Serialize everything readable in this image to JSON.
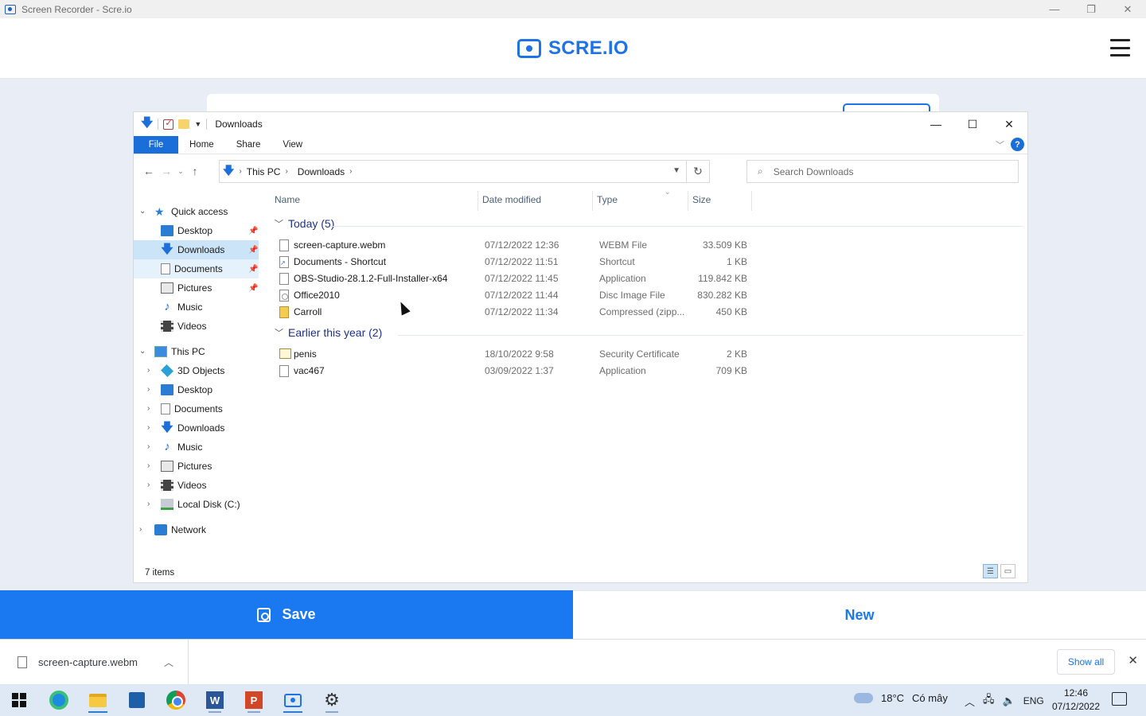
{
  "app_window": {
    "title": "Screen Recorder - Scre.io",
    "controls": [
      "—",
      "❐",
      "✕"
    ]
  },
  "site": {
    "logo_text": "SCRE.IO"
  },
  "explorer": {
    "title": "Downloads",
    "ribbon_tabs": [
      "File",
      "Home",
      "Share",
      "View"
    ],
    "breadcrumb": [
      "This PC",
      "Downloads"
    ],
    "search_placeholder": "Search Downloads",
    "nav": {
      "quick_access": "Quick access",
      "quick_items": [
        "Desktop",
        "Downloads",
        "Documents",
        "Pictures",
        "Music",
        "Videos"
      ],
      "this_pc": "This PC",
      "pc_items": [
        "3D Objects",
        "Desktop",
        "Documents",
        "Downloads",
        "Music",
        "Pictures",
        "Videos",
        "Local Disk (C:)"
      ],
      "network": "Network"
    },
    "columns": {
      "name": "Name",
      "date": "Date modified",
      "type": "Type",
      "size": "Size"
    },
    "groups": [
      {
        "label": "Today (5)",
        "files": [
          {
            "name": "screen-capture.webm",
            "date": "07/12/2022 12:36",
            "type": "WEBM File",
            "size": "33.509 KB",
            "icon": "file-icon"
          },
          {
            "name": "Documents - Shortcut",
            "date": "07/12/2022 11:51",
            "type": "Shortcut",
            "size": "1 KB",
            "icon": "shortcut-icon"
          },
          {
            "name": "OBS-Studio-28.1.2-Full-Installer-x64",
            "date": "07/12/2022 11:45",
            "type": "Application",
            "size": "119.842 KB",
            "icon": "file-icon"
          },
          {
            "name": "Office2010",
            "date": "07/12/2022 11:44",
            "type": "Disc Image File",
            "size": "830.282 KB",
            "icon": "disc-image-icon"
          },
          {
            "name": "Carroll",
            "date": "07/12/2022 11:34",
            "type": "Compressed (zipp...",
            "size": "450 KB",
            "icon": "zip-folder-icon"
          }
        ]
      },
      {
        "label": "Earlier this year (2)",
        "files": [
          {
            "name": "penis",
            "date": "18/10/2022 9:58",
            "type": "Security Certificate",
            "size": "2 KB",
            "icon": "certificate-icon"
          },
          {
            "name": "vac467",
            "date": "03/09/2022 1:37",
            "type": "Application",
            "size": "709 KB",
            "icon": "file-icon"
          }
        ]
      }
    ],
    "status": "7 items"
  },
  "actions": {
    "save_label": "Save",
    "new_label": "New"
  },
  "download_bar": {
    "file_name": "screen-capture.webm",
    "show_all_label": "Show all"
  },
  "taskbar": {
    "weather_temp": "18°C",
    "weather_text": "Có mây",
    "language": "ENG",
    "time": "12:46",
    "date": "07/12/2022"
  },
  "colors": {
    "accent": "#1a78f0",
    "explorer_blue": "#1a6ed9",
    "selected_bg": "#cce4f7"
  }
}
